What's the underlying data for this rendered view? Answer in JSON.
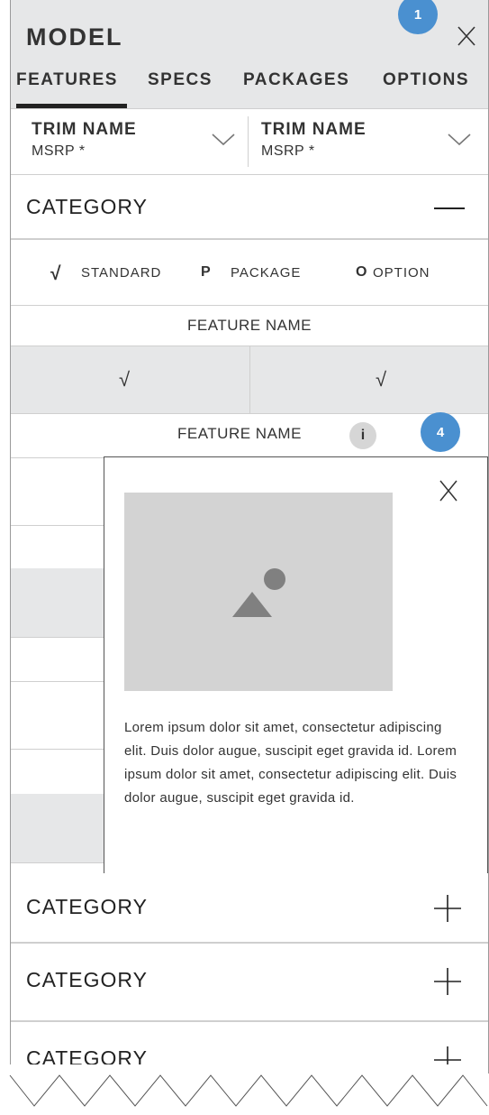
{
  "header": {
    "title": "MODEL",
    "close_label": "X",
    "step_badge": "1",
    "tabs": [
      {
        "label": "FEATURES"
      },
      {
        "label": "SPECS"
      },
      {
        "label": "PACKAGES"
      },
      {
        "label": "OPTIONS"
      }
    ]
  },
  "trims": [
    {
      "name": "TRIM NAME",
      "price": "MSRP *"
    },
    {
      "name": "TRIM NAME",
      "price": "MSRP *"
    }
  ],
  "category_open": {
    "label": "CATEGORY",
    "toggle": "—"
  },
  "legend": {
    "standard_symbol": "√",
    "standard_label": "STANDARD",
    "package_symbol": "P",
    "package_label": "PACKAGE",
    "option_symbol": "O",
    "option_label": "OPTION"
  },
  "features": [
    {
      "name": "FEATURE NAME",
      "values": [
        "√",
        "√"
      ]
    },
    {
      "name": "FEATURE NAME",
      "info": "i"
    }
  ],
  "step_badge_2": "4",
  "popup": {
    "close_label": "X",
    "description": "Lorem ipsum dolor sit amet, consectetur adipiscing elit. Duis dolor augue, suscipit eget gravida id. Lorem ipsum dolor sit amet, consectetur adipiscing elit. Duis dolor augue, suscipit eget gravida id."
  },
  "categories_collapsed": [
    {
      "label": "CATEGORY",
      "toggle": "+"
    },
    {
      "label": "CATEGORY",
      "toggle": "+"
    },
    {
      "label": "CATEGORY",
      "toggle": "+"
    }
  ],
  "colors": {
    "header_bg": "#e6e7e8",
    "badge": "#4a90d0",
    "image_placeholder": "#d3d3d3",
    "image_glyph": "#808080"
  }
}
